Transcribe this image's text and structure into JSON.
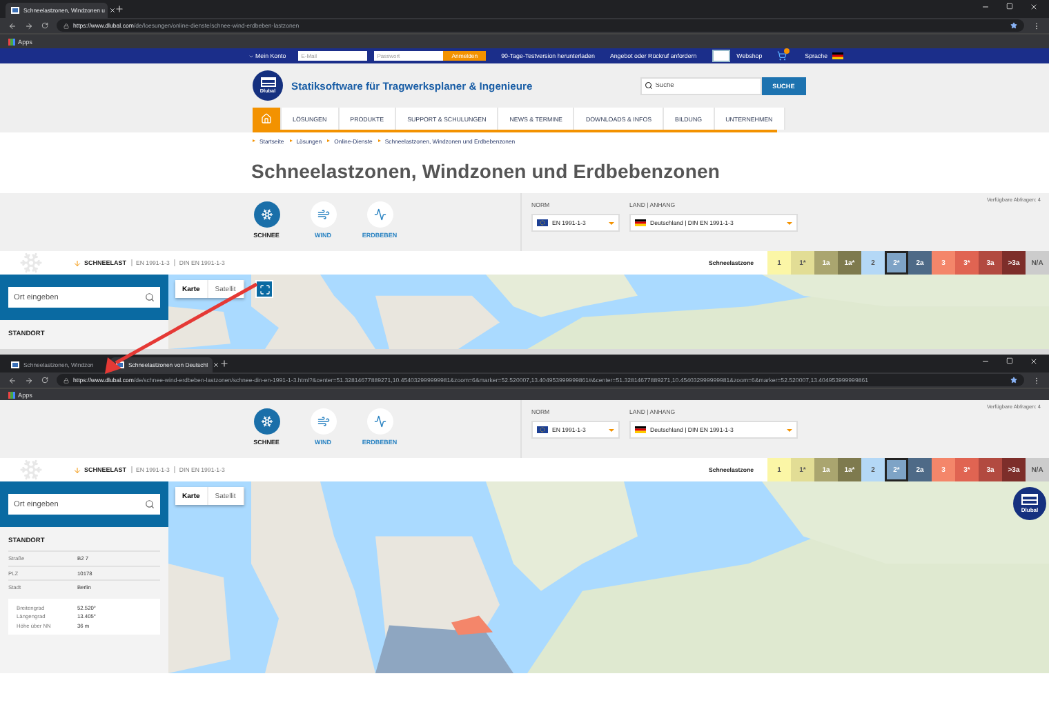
{
  "browser_windows": [
    {
      "tabs": [
        {
          "title": "Schneelastzonen, Windzonen u",
          "selected": true
        }
      ],
      "url": {
        "host": "https://www.dlubal.com",
        "path": "/de/loesungen/online-dienste/schnee-wind-erdbeben-lastzonen"
      },
      "bookmarks": [
        "Apps"
      ],
      "site_header": {
        "account": "Mein Konto",
        "email": {
          "placeholder": "E-Mail"
        },
        "password": {
          "placeholder": "Passwort"
        },
        "login": "Anmelden",
        "links": [
          "90-Tage-Testversion herunterladen",
          "Angebot oder Rückruf anfordern"
        ],
        "webshop": "Webshop",
        "language": "Sprache",
        "logo": "Dlubal",
        "tagline": "Statiksoftware für Tragwerksplaner & Ingenieure",
        "search": {
          "placeholder": "Suche"
        },
        "search_button": "SUCHE"
      },
      "navigation": [
        {
          "kind": "home",
          "selected": true
        },
        {
          "kind": "text",
          "label": "LÖSUNGEN",
          "selected": false
        },
        {
          "kind": "text",
          "label": "PRODUKTE",
          "selected": false
        },
        {
          "kind": "text",
          "label": "SUPPORT & SCHULUNGEN",
          "selected": false
        },
        {
          "kind": "text",
          "label": "NEWS & TERMINE",
          "selected": false
        },
        {
          "kind": "text",
          "label": "DOWNLOADS & INFOS",
          "selected": false
        },
        {
          "kind": "text",
          "label": "BILDUNG",
          "selected": false
        },
        {
          "kind": "text",
          "label": "UNTERNEHMEN",
          "selected": false
        }
      ],
      "breadcrumb": [
        "Startseite",
        "Lösungen",
        "Online-Dienste",
        "Schneelastzonen, Windzonen und Erdbebenzonen"
      ],
      "page_title": "Schneelastzonen, Windzonen und Erdbebenzonen",
      "selector": {
        "hazards": [
          {
            "kind": "snow",
            "label": "SCHNEE",
            "selected": true
          },
          {
            "kind": "wind",
            "label": "WIND",
            "selected": false
          },
          {
            "kind": "earthquake",
            "label": "ERDBEBEN",
            "selected": false
          }
        ],
        "norm": {
          "label": "NORM",
          "value": "EN 1991-1-3"
        },
        "country": {
          "label": "LAND | ANHANG",
          "value": "Deutschland | DIN EN 1991-1-3"
        },
        "queries": "Verfügbare Abfragen: 4"
      },
      "zone_bar": {
        "load": "SCHNEELAST",
        "standards": [
          "EN 1991-1-3",
          "DIN EN 1991-1-3"
        ],
        "legend_label": "Schneelastzone",
        "zones": [
          {
            "label": "1",
            "color": "#fbf6a6",
            "selected": false
          },
          {
            "label": "1*",
            "color": "#e2dd95",
            "selected": false
          },
          {
            "label": "1a",
            "color": "#aaa56f",
            "selected": false
          },
          {
            "label": "1a*",
            "color": "#7e7a4e",
            "selected": false
          },
          {
            "label": "2",
            "color": "#b4d8f6",
            "selected": false
          },
          {
            "label": "2*",
            "color": "#7ea3c6",
            "selected": true
          },
          {
            "label": "2a",
            "color": "#4e6a87",
            "selected": false
          },
          {
            "label": "3",
            "color": "#f4866a",
            "selected": false
          },
          {
            "label": "3*",
            "color": "#e06452",
            "selected": false
          },
          {
            "label": "3a",
            "color": "#b24a40",
            "selected": false
          },
          {
            "label": ">3a",
            "color": "#7d2e2a",
            "selected": false
          },
          {
            "label": "N/A",
            "color": "#cccccc",
            "selected": false
          }
        ]
      },
      "map_section": {
        "search": {
          "placeholder": "Ort eingeben"
        },
        "location": {
          "title": "STANDORT"
        },
        "map_types": [
          {
            "label": "Karte",
            "selected": true
          },
          {
            "label": "Satellit",
            "selected": false
          }
        ],
        "fullscreen_button": true
      }
    },
    {
      "tabs": [
        {
          "title": "Schneelastzonen, Windzon",
          "selected": false
        },
        {
          "title": "Schneelastzonen von Deutschl",
          "selected": true
        }
      ],
      "url": {
        "host": "https://www.dlubal.com",
        "path": "/de/schnee-wind-erdbeben-lastzonen/schnee-din-en-1991-1-3.html?&center=51.32814677889271,10.454032999999981&zoom=6&marker=52.520007,13.404953999999861#&center=51.32814677889271,10.454032999999981&zoom=6&marker=52.520007,13.404953999999861"
      },
      "bookmarks": [
        "Apps"
      ],
      "selector": {
        "hazards": [
          {
            "kind": "snow",
            "label": "SCHNEE",
            "selected": true
          },
          {
            "kind": "wind",
            "label": "WIND",
            "selected": false
          },
          {
            "kind": "earthquake",
            "label": "ERDBEBEN",
            "selected": false
          }
        ],
        "norm": {
          "label": "NORM",
          "value": "EN 1991-1-3"
        },
        "country": {
          "label": "LAND | ANHANG",
          "value": "Deutschland | DIN EN 1991-1-3"
        },
        "queries": "Verfügbare Abfragen: 4"
      },
      "zone_bar": {
        "load": "SCHNEELAST",
        "standards": [
          "EN 1991-1-3",
          "DIN EN 1991-1-3"
        ],
        "legend_label": "Schneelastzone",
        "zones": [
          {
            "label": "1",
            "color": "#fbf6a6",
            "selected": false
          },
          {
            "label": "1*",
            "color": "#e2dd95",
            "selected": false
          },
          {
            "label": "1a",
            "color": "#aaa56f",
            "selected": false
          },
          {
            "label": "1a*",
            "color": "#7e7a4e",
            "selected": false
          },
          {
            "label": "2",
            "color": "#b4d8f6",
            "selected": false
          },
          {
            "label": "2*",
            "color": "#7ea3c6",
            "selected": true
          },
          {
            "label": "2a",
            "color": "#4e6a87",
            "selected": false
          },
          {
            "label": "3",
            "color": "#f4866a",
            "selected": false
          },
          {
            "label": "3*",
            "color": "#e06452",
            "selected": false
          },
          {
            "label": "3a",
            "color": "#b24a40",
            "selected": false
          },
          {
            "label": ">3a",
            "color": "#7d2e2a",
            "selected": false
          },
          {
            "label": "N/A",
            "color": "#cccccc",
            "selected": false
          }
        ]
      },
      "map_section": {
        "search": {
          "placeholder": "Ort eingeben"
        },
        "location": {
          "title": "STANDORT",
          "rows": [
            {
              "label": "Straße",
              "value": "B2 7"
            },
            {
              "label": "PLZ",
              "value": "10178"
            },
            {
              "label": "Stadt",
              "value": "Berlin"
            }
          ],
          "coordinates": [
            {
              "label": "Breitengrad",
              "value": "52.520°"
            },
            {
              "label": "Längengrad",
              "value": "13.405°"
            },
            {
              "label": "Höhe über NN",
              "value": "36 m"
            }
          ]
        },
        "map_types": [
          {
            "label": "Karte",
            "selected": true
          },
          {
            "label": "Satellit",
            "selected": false
          }
        ],
        "logo": "Dlubal"
      }
    }
  ]
}
